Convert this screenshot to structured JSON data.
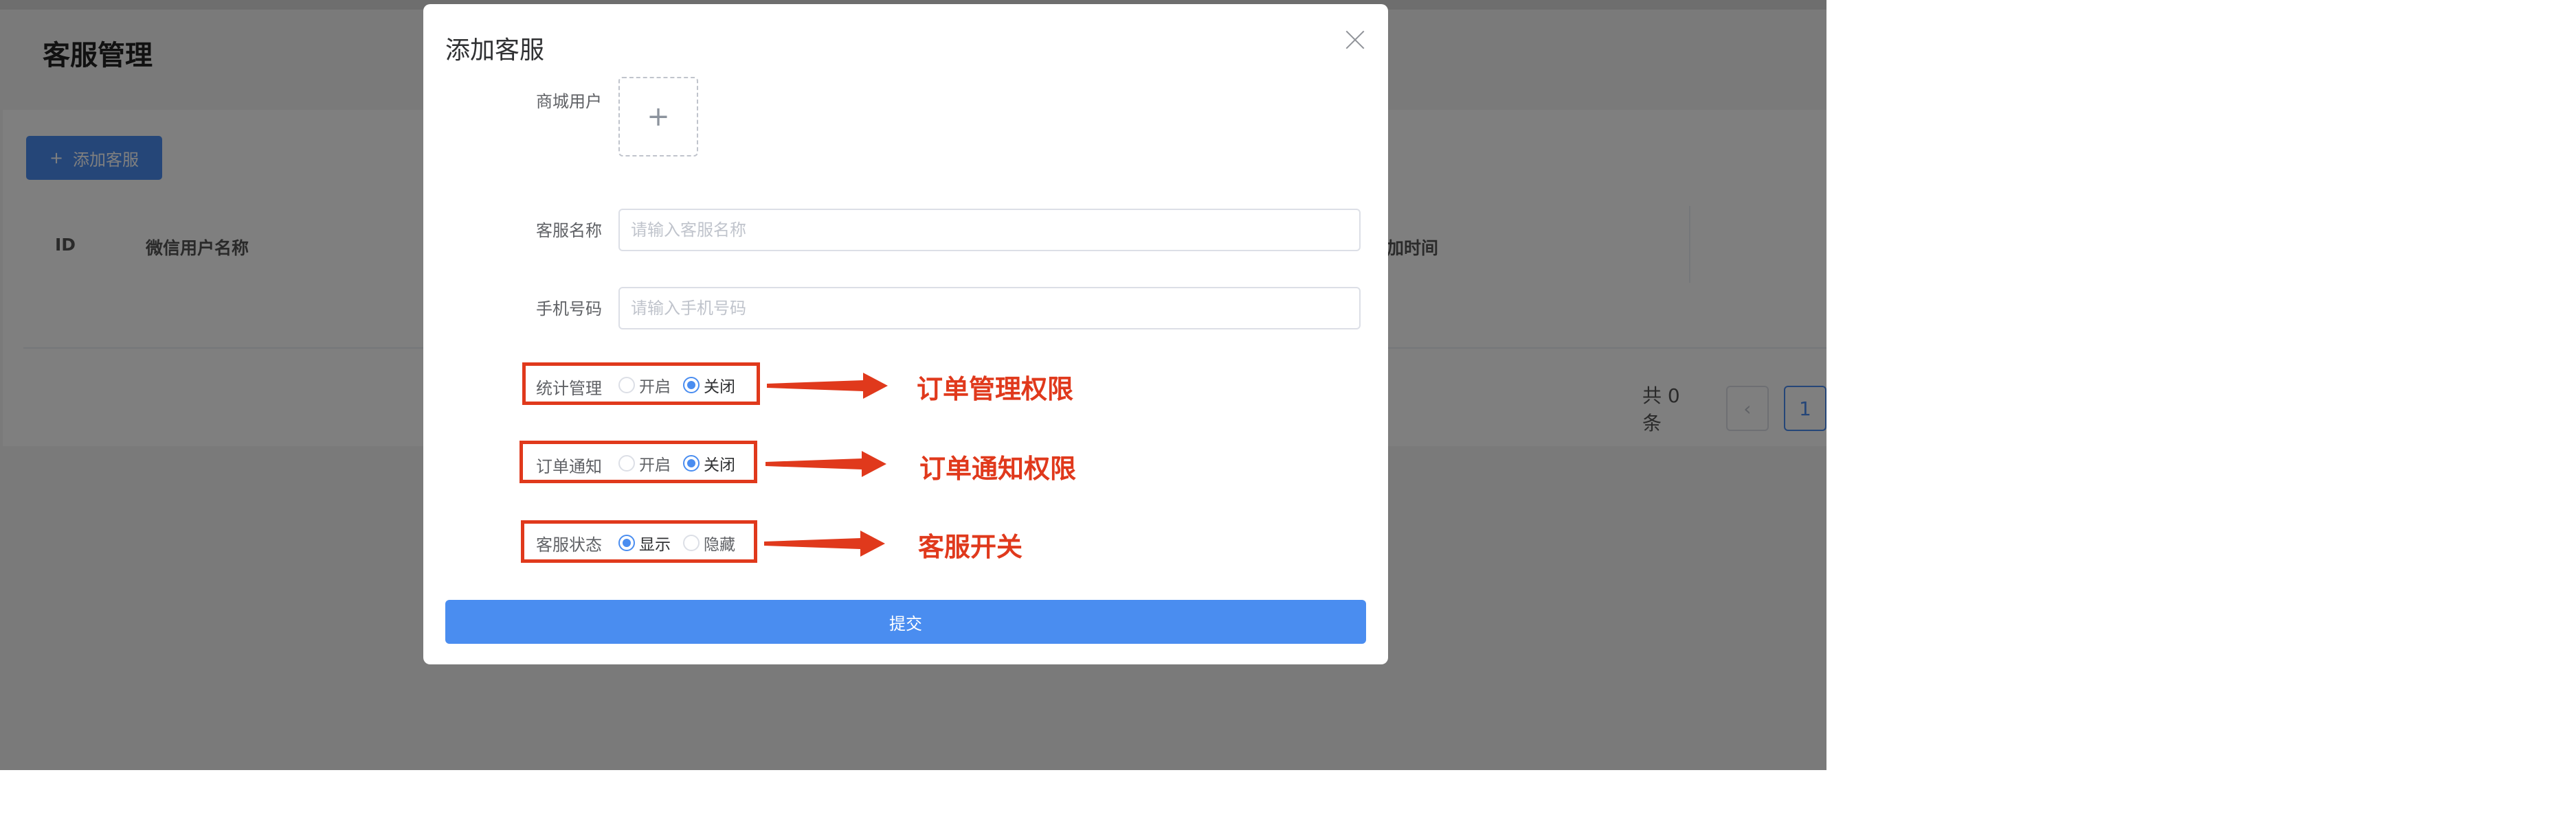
{
  "page": {
    "title": "客服管理",
    "add_button_label": "添加客服",
    "table_headers": [
      "ID",
      "微信用户名称",
      "加时间"
    ],
    "pagination": {
      "total_text": "共 0 条",
      "prev_label": "‹",
      "current_page": "1"
    }
  },
  "dialog": {
    "title": "添加客服",
    "fields": {
      "mall_user_label": "商城用户",
      "upload_plus": "+",
      "name_label": "客服名称",
      "name_value": "",
      "name_placeholder": "请输入客服名称",
      "phone_label": "手机号码",
      "phone_value": "",
      "phone_placeholder": "请输入手机号码",
      "stats_label": "统计管理",
      "stats_options": [
        "开启",
        "关闭"
      ],
      "stats_selected": "关闭",
      "order_notice_label": "订单通知",
      "order_notice_options": [
        "开启",
        "关闭"
      ],
      "order_notice_selected": "关闭",
      "status_label": "客服状态",
      "status_options": [
        "显示",
        "隐藏"
      ],
      "status_selected": "显示"
    },
    "submit_label": "提交"
  },
  "annotations": {
    "color": "#e0391c",
    "notes": [
      "订单管理权限",
      "订单通知权限",
      "客服开关"
    ]
  },
  "colors": {
    "primary": "#4a8df0",
    "overlay": "rgba(0,0,0,0.5)",
    "annotation": "#e0391c"
  },
  "icons": [
    "close-icon",
    "plus-icon",
    "radio-icon",
    "arrow-right-icon",
    "chevron-left-icon"
  ]
}
